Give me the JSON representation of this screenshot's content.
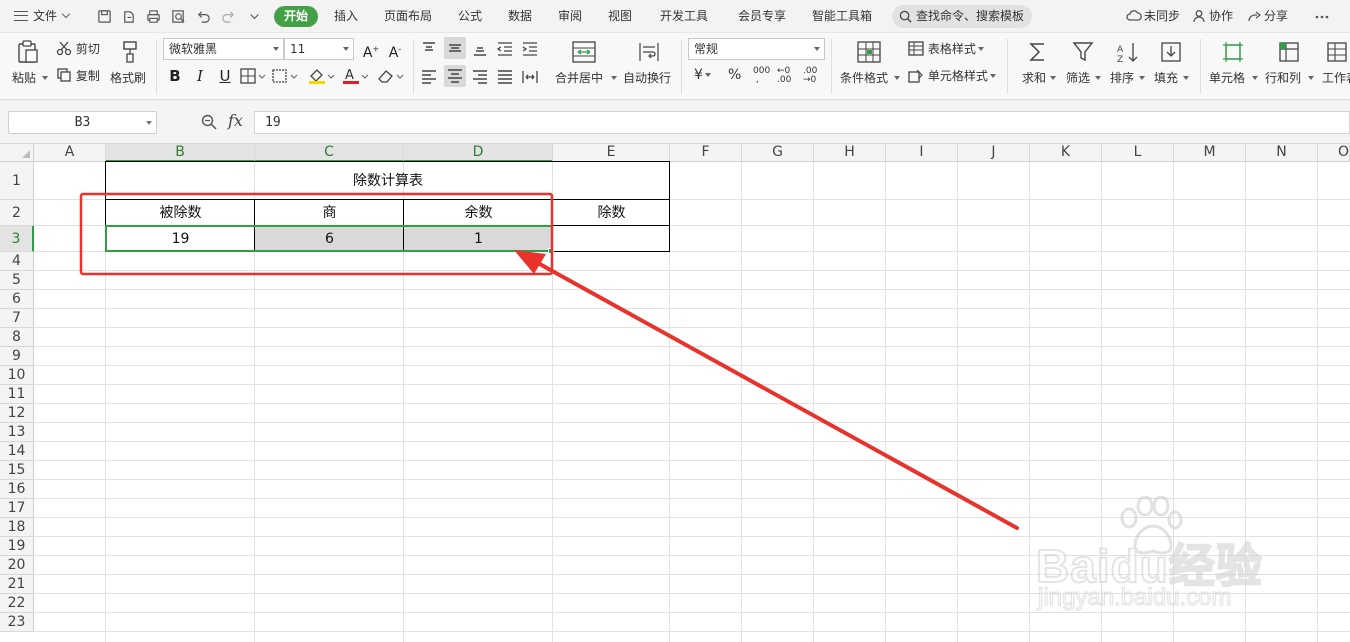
{
  "menubar": {
    "file_label": "文件",
    "tabs": [
      "开始",
      "插入",
      "页面布局",
      "公式",
      "数据",
      "审阅",
      "视图",
      "开发工具",
      "会员专享",
      "智能工具箱"
    ],
    "search_placeholder": "查找命令、搜索模板",
    "sync_label": "未同步",
    "collab_label": "协作",
    "share_label": "分享"
  },
  "ribbon": {
    "paste": "粘贴",
    "cut": "剪切",
    "copy": "复制",
    "format_painter": "格式刷",
    "font_name": "微软雅黑",
    "font_size": "11",
    "merge_center": "合并居中",
    "wrap_text": "自动换行",
    "number_format": "常规",
    "cond_format": "条件格式",
    "table_style": "表格样式",
    "cell_style": "单元格样式",
    "sum": "求和",
    "filter": "筛选",
    "sort": "排序",
    "fill": "填充",
    "cell": "单元格",
    "rows_cols": "行和列",
    "worksheet": "工作表"
  },
  "formula_bar": {
    "cell_ref": "B3",
    "fx_label": "fx",
    "value": "19"
  },
  "sheet": {
    "columns": [
      "A",
      "B",
      "C",
      "D",
      "E",
      "F",
      "G",
      "H",
      "I",
      "J",
      "K",
      "L",
      "M",
      "N",
      "O"
    ],
    "rows": [
      "1",
      "2",
      "3",
      "4",
      "5",
      "6",
      "7",
      "8",
      "9",
      "10",
      "11",
      "12",
      "13",
      "14",
      "15",
      "16",
      "17",
      "18",
      "19",
      "20",
      "21",
      "22",
      "23"
    ],
    "selected_column_range": [
      "B",
      "D"
    ],
    "selected_row": "3",
    "title": "除数计算表",
    "headers": [
      "被除数",
      "商",
      "余数",
      "除数"
    ],
    "values": [
      "19",
      "6",
      "1",
      ""
    ]
  },
  "annotation_colors": {
    "red_box": "#e8322c",
    "arrow": "#e8322c",
    "selection": "#2e9e47",
    "brand_green": "#43a047"
  },
  "watermark": {
    "line1": "Baidu经验",
    "line2": "jingyan.baidu.com"
  }
}
